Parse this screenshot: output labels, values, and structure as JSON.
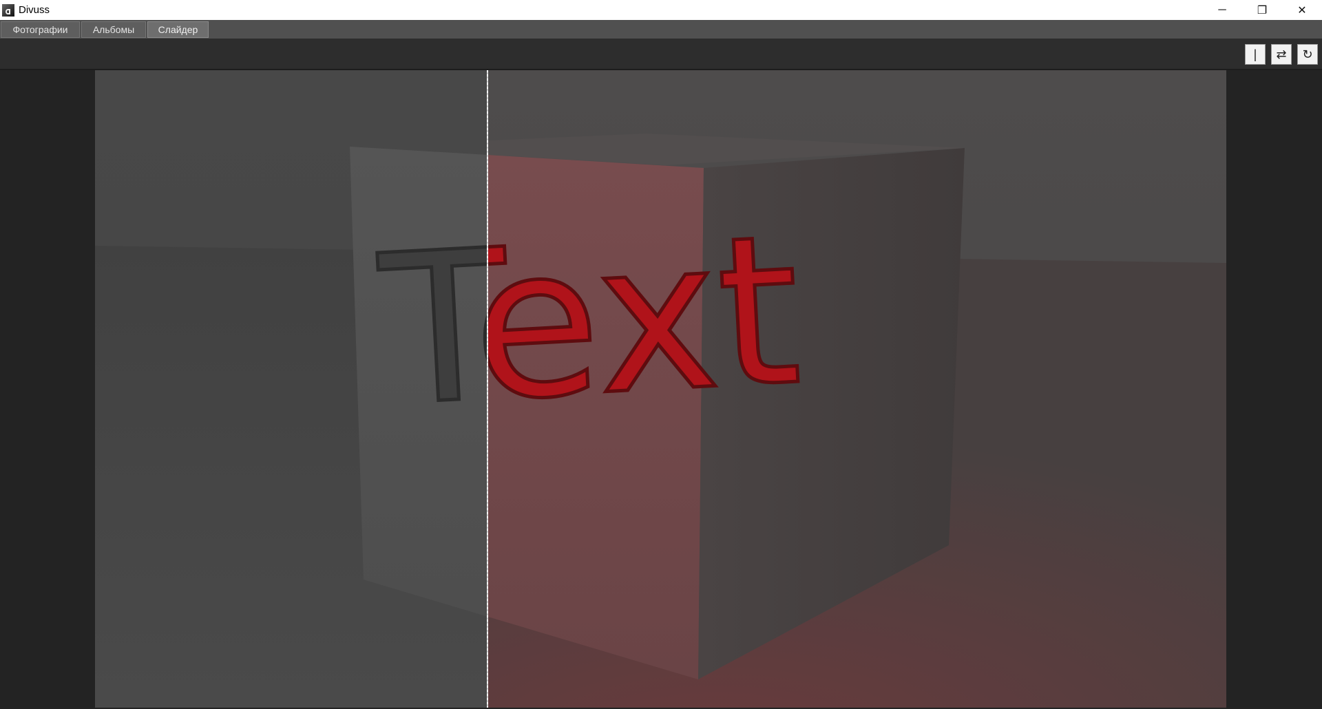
{
  "window": {
    "title": "Divuss",
    "icon": "app-icon",
    "controls": {
      "minimize": "─",
      "maximize": "❐",
      "close": "✕"
    }
  },
  "tabs": [
    {
      "label": "Фотографии",
      "active": false
    },
    {
      "label": "Альбомы",
      "active": false
    },
    {
      "label": "Слайдер",
      "active": true
    }
  ],
  "toolbar": {
    "buttons": [
      {
        "icon": "divider-line-icon",
        "glyph": "|"
      },
      {
        "icon": "swap-arrows-icon",
        "glyph": "⇄"
      },
      {
        "icon": "refresh-icon",
        "glyph": "↻"
      }
    ]
  },
  "slider": {
    "split_fraction": 0.347,
    "left_image": "grayscale-cube-render",
    "right_image": "red-text-cube-render",
    "render_text": "Text"
  },
  "colors": {
    "accent_red": "#c4141a",
    "background": "#232323",
    "tabbar": "#505050"
  }
}
